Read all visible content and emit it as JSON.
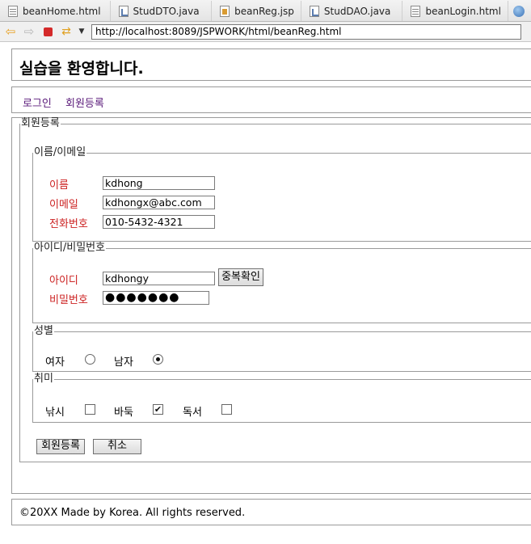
{
  "browser": {
    "tabs": [
      {
        "label": "beanHome.html",
        "icon": "html-file-icon"
      },
      {
        "label": "StudDTO.java",
        "icon": "java-file-icon"
      },
      {
        "label": "beanReg.jsp",
        "icon": "jsp-file-icon"
      },
      {
        "label": "StudDAO.java",
        "icon": "java-file-icon"
      },
      {
        "label": "beanLogin.html",
        "icon": "html-file-icon"
      }
    ],
    "url": "http://localhost:8089/JSPWORK/html/beanReg.html"
  },
  "header": {
    "title": "실습을 환영합니다."
  },
  "menu": {
    "login": "로그인",
    "register": "회원등록"
  },
  "form": {
    "legend": "회원등록",
    "name_email": {
      "legend": "이름/이메일",
      "name_label": "이름",
      "name_value": "kdhong",
      "email_label": "이메일",
      "email_value": "kdhongx@abc.com",
      "phone_label": "전화번호",
      "phone_value": "010-5432-4321"
    },
    "account": {
      "legend": "아이디/비밀번호",
      "id_label": "아이디",
      "id_value": "kdhongy",
      "dup_check_label": "중복확인",
      "pw_label": "비밀번호",
      "pw_value": "●●●●●●●"
    },
    "gender": {
      "legend": "성별",
      "female_label": "여자",
      "female_checked": false,
      "male_label": "남자",
      "male_checked": true
    },
    "hobby": {
      "legend": "취미",
      "fishing_label": "낚시",
      "fishing_checked": false,
      "baduk_label": "바둑",
      "baduk_checked": true,
      "reading_label": "독서",
      "reading_checked": false
    },
    "submit_label": "회원등록",
    "cancel_label": "취소"
  },
  "footer": {
    "text": "©20XX Made by Korea. All rights reserved."
  }
}
